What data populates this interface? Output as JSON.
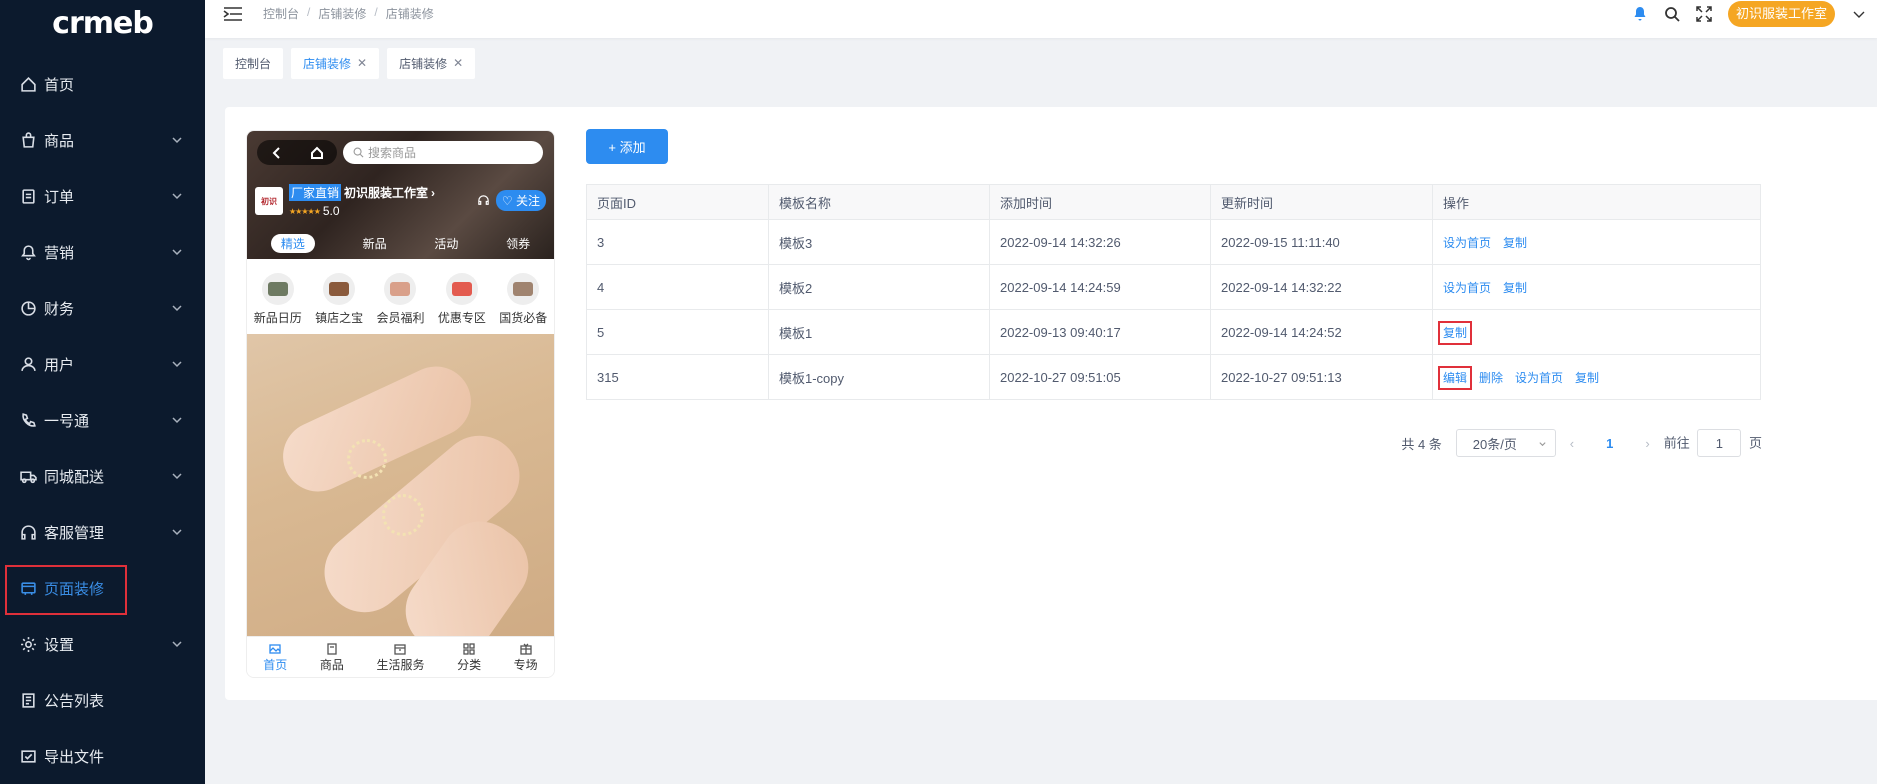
{
  "logo": {
    "text": "crmeb"
  },
  "sidebar": {
    "items": [
      {
        "label": "首页",
        "icon": "home-icon",
        "hasChildren": false
      },
      {
        "label": "商品",
        "icon": "bag-icon",
        "hasChildren": true
      },
      {
        "label": "订单",
        "icon": "order-icon",
        "hasChildren": true
      },
      {
        "label": "营销",
        "icon": "bell-icon",
        "hasChildren": true
      },
      {
        "label": "财务",
        "icon": "pie-chart-icon",
        "hasChildren": true
      },
      {
        "label": "用户",
        "icon": "user-icon",
        "hasChildren": true
      },
      {
        "label": "一号通",
        "icon": "phone-icon",
        "hasChildren": true
      },
      {
        "label": "同城配送",
        "icon": "truck-icon",
        "hasChildren": true
      },
      {
        "label": "客服管理",
        "icon": "headset-icon",
        "hasChildren": true
      },
      {
        "label": "页面装修",
        "icon": "decoration-icon",
        "hasChildren": false,
        "active": true
      },
      {
        "label": "设置",
        "icon": "gear-icon",
        "hasChildren": true
      },
      {
        "label": "公告列表",
        "icon": "notice-icon",
        "hasChildren": false
      },
      {
        "label": "导出文件",
        "icon": "export-icon",
        "hasChildren": false
      }
    ]
  },
  "header": {
    "breadcrumb": [
      "控制台",
      "店铺装修",
      "店铺装修"
    ],
    "user": "初识服装工作室"
  },
  "tabs": [
    {
      "label": "控制台",
      "closable": false,
      "active": false
    },
    {
      "label": "店铺装修",
      "closable": true,
      "active": true
    },
    {
      "label": "店铺装修",
      "closable": true,
      "active": false
    }
  ],
  "preview": {
    "search_placeholder": "搜索商品",
    "shop_tag": "厂家直销",
    "shop_name": "初识服装工作室",
    "shop_logo_text": "初识",
    "rating": "5.0",
    "follow_label": "关注",
    "category_tabs": [
      "精选",
      "新品",
      "活动",
      "领券"
    ],
    "quick_icons": [
      {
        "label": "新品日历",
        "color": "#6e7a62"
      },
      {
        "label": "镇店之宝",
        "color": "#8a5a3c"
      },
      {
        "label": "会员福利",
        "color": "#d9a08a"
      },
      {
        "label": "优惠专区",
        "color": "#e35b4f"
      },
      {
        "label": "国货必备",
        "color": "#a08470"
      }
    ],
    "bottom_nav": [
      {
        "label": "首页",
        "active": true
      },
      {
        "label": "商品",
        "active": false
      },
      {
        "label": "生活服务",
        "active": false
      },
      {
        "label": "分类",
        "active": false
      },
      {
        "label": "专场",
        "active": false
      }
    ]
  },
  "toolbar": {
    "add_label": "+ 添加"
  },
  "table": {
    "headers": [
      "页面ID",
      "模板名称",
      "添加时间",
      "更新时间",
      "操作"
    ],
    "rows": [
      {
        "id": "3",
        "name": "模板3",
        "added": "2022-09-14 14:32:26",
        "updated": "2022-09-15 11:11:40",
        "ops": [
          "设为首页",
          "复制"
        ]
      },
      {
        "id": "4",
        "name": "模板2",
        "added": "2022-09-14 14:24:59",
        "updated": "2022-09-14 14:32:22",
        "ops": [
          "设为首页",
          "复制"
        ]
      },
      {
        "id": "5",
        "name": "模板1",
        "added": "2022-09-13 09:40:17",
        "updated": "2022-09-14 14:24:52",
        "ops": [
          "复制"
        ]
      },
      {
        "id": "315",
        "name": "模板1-copy",
        "added": "2022-10-27 09:51:05",
        "updated": "2022-10-27 09:51:13",
        "ops": [
          "编辑",
          "删除",
          "设为首页",
          "复制"
        ]
      }
    ]
  },
  "pagination": {
    "total_text": "共 4 条",
    "page_size": "20条/页",
    "current_page": "1",
    "goto_label": "前往",
    "goto_value": "1",
    "page_suffix": "页"
  },
  "colors": {
    "primary": "#2d8cf0",
    "sidebar_bg": "#0c1a2d",
    "badge": "#f5a623",
    "highlight": "#e0303a"
  }
}
